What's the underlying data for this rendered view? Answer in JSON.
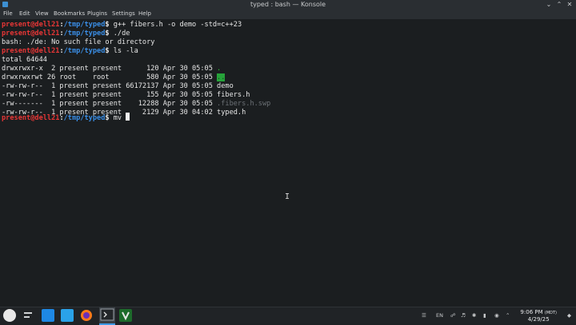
{
  "window": {
    "title": "typed : bash — Konsole"
  },
  "menu": [
    "File",
    "Edit",
    "View",
    "Bookmarks",
    "Plugins",
    "Settings",
    "Help"
  ],
  "prompt": {
    "user": "present@dell21",
    "sep": ":",
    "path": "/tmp/typed",
    "dollar": "$"
  },
  "terminal": {
    "cmd1": " g++ fibers.h -o demo -std=c++23",
    "cmd2": " ./de",
    "err": "bash: ./de: No such file or directory",
    "cmd3": " ls -la",
    "total": "total 64644",
    "ls": [
      {
        "meta": "drwxrwxr-x  2 present present      120 Apr 30 05:05 ",
        "name": "."
      },
      {
        "meta": "drwxrwxrwt 26 root    root         580 Apr 30 05:05 ",
        "name": ".."
      },
      {
        "meta": "-rw-rw-r--  1 present present 66172137 Apr 30 05:05 ",
        "name": "demo"
      },
      {
        "meta": "-rw-rw-r--  1 present present      155 Apr 30 05:05 ",
        "name": "fibers.h"
      },
      {
        "meta": "-rw-------  1 present present    12288 Apr 30 05:05 ",
        "name": ".fibers.h.swp"
      },
      {
        "meta": "-rw-rw-r--  1 present present     2129 Apr 30 04:02 ",
        "name": "typed.h"
      }
    ],
    "cmd4": " mv "
  },
  "taskbar": {
    "lang": "EN",
    "time": "9:06 PM",
    "tz": "(MDT)",
    "date": "4/29/25",
    "icons": [
      "app-launcher-icon",
      "pager-icon",
      "file-manager-icon",
      "dolphin-icon",
      "firefox-icon",
      "konsole-icon",
      "vim-icon"
    ]
  }
}
